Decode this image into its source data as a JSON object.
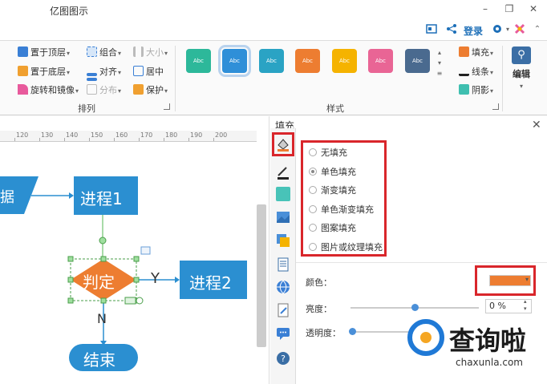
{
  "window": {
    "title": "亿图图示",
    "minimize": "–",
    "restore": "❐",
    "close": "✕"
  },
  "toprow": {
    "login": "登录"
  },
  "ribbon": {
    "arrange": {
      "bring_front": "置于顶层",
      "send_back": "置于底层",
      "rotate_mirror": "旋转和镜像",
      "group": "组合",
      "align": "对齐",
      "distribute": "分布",
      "size": "大小",
      "center": "居中",
      "protect": "保护",
      "label": "排列"
    },
    "styles": {
      "label": "样式",
      "swatches": [
        {
          "text": "Abc",
          "color": "#2db89a"
        },
        {
          "text": "Abc",
          "color": "#2f8fd8"
        },
        {
          "text": "Abc",
          "color": "#2aa3c4"
        },
        {
          "text": "Abc",
          "color": "#ed7d31"
        },
        {
          "text": "Abc",
          "color": "#f5b300"
        },
        {
          "text": "Abc",
          "color": "#e96595"
        },
        {
          "text": "Abc",
          "color": "#4a6a8f"
        }
      ]
    },
    "format": {
      "fill": "填充",
      "line": "线条",
      "shadow": "阴影"
    },
    "edit": {
      "label": "编辑"
    }
  },
  "canvas": {
    "ruler_ticks": [
      "120",
      "130",
      "140",
      "150",
      "160",
      "170",
      "180",
      "190",
      "200"
    ],
    "shapes": {
      "data": "据",
      "process1": "进程1",
      "decision": "判定",
      "yes": "Y",
      "process2": "进程2",
      "no": "N",
      "end": "结束"
    },
    "colors": {
      "process": "#2b8fd1",
      "decision": "#ed7d31"
    }
  },
  "panel": {
    "title": "填充",
    "fill_options": [
      {
        "label": "无填充",
        "selected": false
      },
      {
        "label": "单色填充",
        "selected": true
      },
      {
        "label": "渐变填充",
        "selected": false
      },
      {
        "label": "单色渐变填充",
        "selected": false
      },
      {
        "label": "图案填充",
        "selected": false
      },
      {
        "label": "图片或纹理填充",
        "selected": false
      }
    ],
    "color_label": "颜色：",
    "color_value": "#ed7d31",
    "brightness_label": "亮度：",
    "brightness_value": "0 %",
    "transparency_label": "透明度："
  },
  "watermark": {
    "text": "查询啦",
    "domain": "chaxunla.com"
  }
}
